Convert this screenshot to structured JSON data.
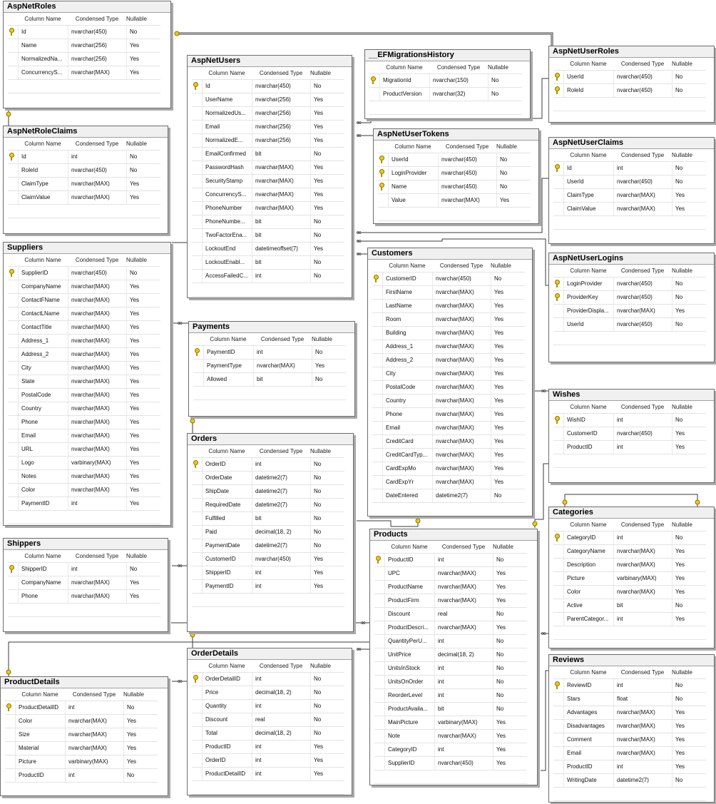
{
  "columns_header": {
    "name": "Column Name",
    "type": "Condensed Type",
    "nullable": "Nullable"
  },
  "tables": [
    {
      "name": "AspNetRoles",
      "rows": [
        {
          "col": "Id",
          "type": "nvarchar(450)",
          "nullable": "No",
          "pk": true
        },
        {
          "col": "Name",
          "type": "nvarchar(256)",
          "nullable": "Yes"
        },
        {
          "col": "NormalizedNa...",
          "type": "nvarchar(256)",
          "nullable": "Yes"
        },
        {
          "col": "ConcurrencyS...",
          "type": "nvarchar(MAX)",
          "nullable": "Yes"
        }
      ]
    },
    {
      "name": "AspNetRoleClaims",
      "rows": [
        {
          "col": "Id",
          "type": "int",
          "nullable": "No",
          "pk": true
        },
        {
          "col": "RoleId",
          "type": "nvarchar(450)",
          "nullable": "No"
        },
        {
          "col": "ClaimType",
          "type": "nvarchar(MAX)",
          "nullable": "Yes"
        },
        {
          "col": "ClaimValue",
          "type": "nvarchar(MAX)",
          "nullable": "Yes"
        }
      ]
    },
    {
      "name": "Suppliers",
      "rows": [
        {
          "col": "SupplierID",
          "type": "nvarchar(450)",
          "nullable": "No",
          "pk": true
        },
        {
          "col": "CompanyName",
          "type": "nvarchar(MAX)",
          "nullable": "Yes"
        },
        {
          "col": "ContactFName",
          "type": "nvarchar(MAX)",
          "nullable": "Yes"
        },
        {
          "col": "ContactLName",
          "type": "nvarchar(MAX)",
          "nullable": "Yes"
        },
        {
          "col": "ContactTitle",
          "type": "nvarchar(MAX)",
          "nullable": "Yes"
        },
        {
          "col": "Address_1",
          "type": "nvarchar(MAX)",
          "nullable": "Yes"
        },
        {
          "col": "Address_2",
          "type": "nvarchar(MAX)",
          "nullable": "Yes"
        },
        {
          "col": "City",
          "type": "nvarchar(MAX)",
          "nullable": "Yes"
        },
        {
          "col": "State",
          "type": "nvarchar(MAX)",
          "nullable": "Yes"
        },
        {
          "col": "PostalCode",
          "type": "nvarchar(MAX)",
          "nullable": "Yes"
        },
        {
          "col": "Country",
          "type": "nvarchar(MAX)",
          "nullable": "Yes"
        },
        {
          "col": "Phone",
          "type": "nvarchar(MAX)",
          "nullable": "Yes"
        },
        {
          "col": "Email",
          "type": "nvarchar(MAX)",
          "nullable": "Yes"
        },
        {
          "col": "URL",
          "type": "nvarchar(MAX)",
          "nullable": "Yes"
        },
        {
          "col": "Logo",
          "type": "varbinary(MAX)",
          "nullable": "Yes"
        },
        {
          "col": "Notes",
          "type": "nvarchar(MAX)",
          "nullable": "Yes"
        },
        {
          "col": "Color",
          "type": "nvarchar(MAX)",
          "nullable": "Yes"
        },
        {
          "col": "PaymentID",
          "type": "int",
          "nullable": "Yes"
        }
      ]
    },
    {
      "name": "Shippers",
      "rows": [
        {
          "col": "ShipperID",
          "type": "int",
          "nullable": "No",
          "pk": true
        },
        {
          "col": "CompanyName",
          "type": "nvarchar(MAX)",
          "nullable": "Yes"
        },
        {
          "col": "Phone",
          "type": "nvarchar(MAX)",
          "nullable": "Yes"
        }
      ]
    },
    {
      "name": "ProductDetails",
      "rows": [
        {
          "col": "ProductDetailID",
          "type": "int",
          "nullable": "No",
          "pk": true
        },
        {
          "col": "Color",
          "type": "nvarchar(MAX)",
          "nullable": "Yes"
        },
        {
          "col": "Size",
          "type": "nvarchar(MAX)",
          "nullable": "Yes"
        },
        {
          "col": "Material",
          "type": "nvarchar(MAX)",
          "nullable": "Yes"
        },
        {
          "col": "Picture",
          "type": "varbinary(MAX)",
          "nullable": "Yes"
        },
        {
          "col": "ProductID",
          "type": "int",
          "nullable": "No"
        }
      ]
    },
    {
      "name": "AspNetUsers",
      "rows": [
        {
          "col": "Id",
          "type": "nvarchar(450)",
          "nullable": "No",
          "pk": true
        },
        {
          "col": "UserName",
          "type": "nvarchar(256)",
          "nullable": "Yes"
        },
        {
          "col": "NormalizedUs...",
          "type": "nvarchar(256)",
          "nullable": "Yes"
        },
        {
          "col": "Email",
          "type": "nvarchar(256)",
          "nullable": "Yes"
        },
        {
          "col": "NormalizedE...",
          "type": "nvarchar(256)",
          "nullable": "Yes"
        },
        {
          "col": "EmailConfirmed",
          "type": "bit",
          "nullable": "No"
        },
        {
          "col": "PasswordHash",
          "type": "nvarchar(MAX)",
          "nullable": "Yes"
        },
        {
          "col": "SecurityStamp",
          "type": "nvarchar(MAX)",
          "nullable": "Yes"
        },
        {
          "col": "ConcurrencyS...",
          "type": "nvarchar(MAX)",
          "nullable": "Yes"
        },
        {
          "col": "PhoneNumber",
          "type": "nvarchar(MAX)",
          "nullable": "Yes"
        },
        {
          "col": "PhoneNumbe...",
          "type": "bit",
          "nullable": "No"
        },
        {
          "col": "TwoFactorEna...",
          "type": "bit",
          "nullable": "No"
        },
        {
          "col": "LockoutEnd",
          "type": "datetimeoffset(7)",
          "nullable": "Yes"
        },
        {
          "col": "LockoutEnabl...",
          "type": "bit",
          "nullable": "No"
        },
        {
          "col": "AccessFailedC...",
          "type": "int",
          "nullable": "No"
        }
      ]
    },
    {
      "name": "Payments",
      "rows": [
        {
          "col": "PaymentID",
          "type": "int",
          "nullable": "No",
          "pk": true
        },
        {
          "col": "PaymentType",
          "type": "nvarchar(MAX)",
          "nullable": "Yes"
        },
        {
          "col": "Allowed",
          "type": "bit",
          "nullable": "No"
        }
      ]
    },
    {
      "name": "Orders",
      "rows": [
        {
          "col": "OrderID",
          "type": "int",
          "nullable": "No",
          "pk": true
        },
        {
          "col": "OrderDate",
          "type": "datetime2(7)",
          "nullable": "No"
        },
        {
          "col": "ShipDate",
          "type": "datetime2(7)",
          "nullable": "No"
        },
        {
          "col": "RequiredDate",
          "type": "datetime2(7)",
          "nullable": "No"
        },
        {
          "col": "Fulfilled",
          "type": "bit",
          "nullable": "No"
        },
        {
          "col": "Paid",
          "type": "decimal(18, 2)",
          "nullable": "No"
        },
        {
          "col": "PaymentDate",
          "type": "datetime2(7)",
          "nullable": "No"
        },
        {
          "col": "CustomerID",
          "type": "nvarchar(450)",
          "nullable": "Yes"
        },
        {
          "col": "ShipperID",
          "type": "int",
          "nullable": "Yes"
        },
        {
          "col": "PaymentID",
          "type": "int",
          "nullable": "Yes"
        }
      ]
    },
    {
      "name": "OrderDetails",
      "rows": [
        {
          "col": "OrderDetailID",
          "type": "int",
          "nullable": "No",
          "pk": true
        },
        {
          "col": "Price",
          "type": "decimal(18, 2)",
          "nullable": "No"
        },
        {
          "col": "Quantity",
          "type": "int",
          "nullable": "No"
        },
        {
          "col": "Discount",
          "type": "real",
          "nullable": "No"
        },
        {
          "col": "Total",
          "type": "decimal(18, 2)",
          "nullable": "No"
        },
        {
          "col": "ProductID",
          "type": "int",
          "nullable": "Yes"
        },
        {
          "col": "OrderID",
          "type": "int",
          "nullable": "Yes"
        },
        {
          "col": "ProductDetailID",
          "type": "int",
          "nullable": "Yes"
        }
      ]
    },
    {
      "name": "__EFMigrationsHistory",
      "rows": [
        {
          "col": "MigrationId",
          "type": "nvarchar(150)",
          "nullable": "No",
          "pk": true
        },
        {
          "col": "ProductVersion",
          "type": "nvarchar(32)",
          "nullable": "No"
        }
      ]
    },
    {
      "name": "AspNetUserTokens",
      "rows": [
        {
          "col": "UserId",
          "type": "nvarchar(450)",
          "nullable": "No",
          "pk": true
        },
        {
          "col": "LoginProvider",
          "type": "nvarchar(450)",
          "nullable": "No",
          "pk": true
        },
        {
          "col": "Name",
          "type": "nvarchar(450)",
          "nullable": "No",
          "pk": true
        },
        {
          "col": "Value",
          "type": "nvarchar(MAX)",
          "nullable": "Yes"
        }
      ]
    },
    {
      "name": "Customers",
      "rows": [
        {
          "col": "CustomerID",
          "type": "nvarchar(450)",
          "nullable": "No",
          "pk": true
        },
        {
          "col": "FirstName",
          "type": "nvarchar(MAX)",
          "nullable": "Yes"
        },
        {
          "col": "LastName",
          "type": "nvarchar(MAX)",
          "nullable": "Yes"
        },
        {
          "col": "Room",
          "type": "nvarchar(MAX)",
          "nullable": "Yes"
        },
        {
          "col": "Building",
          "type": "nvarchar(MAX)",
          "nullable": "Yes"
        },
        {
          "col": "Address_1",
          "type": "nvarchar(MAX)",
          "nullable": "Yes"
        },
        {
          "col": "Address_2",
          "type": "nvarchar(MAX)",
          "nullable": "Yes"
        },
        {
          "col": "City",
          "type": "nvarchar(MAX)",
          "nullable": "Yes"
        },
        {
          "col": "PostalCode",
          "type": "nvarchar(MAX)",
          "nullable": "Yes"
        },
        {
          "col": "Country",
          "type": "nvarchar(MAX)",
          "nullable": "Yes"
        },
        {
          "col": "Phone",
          "type": "nvarchar(MAX)",
          "nullable": "Yes"
        },
        {
          "col": "Email",
          "type": "nvarchar(MAX)",
          "nullable": "Yes"
        },
        {
          "col": "CreditCard",
          "type": "nvarchar(MAX)",
          "nullable": "Yes"
        },
        {
          "col": "CreditCardTyp...",
          "type": "nvarchar(MAX)",
          "nullable": "Yes"
        },
        {
          "col": "CardExpMo",
          "type": "nvarchar(MAX)",
          "nullable": "Yes"
        },
        {
          "col": "CardExpYr",
          "type": "nvarchar(MAX)",
          "nullable": "Yes"
        },
        {
          "col": "DateEntered",
          "type": "datetime2(7)",
          "nullable": "No"
        }
      ]
    },
    {
      "name": "Products",
      "rows": [
        {
          "col": "ProductID",
          "type": "int",
          "nullable": "No",
          "pk": true
        },
        {
          "col": "UPC",
          "type": "nvarchar(MAX)",
          "nullable": "Yes"
        },
        {
          "col": "ProductName",
          "type": "nvarchar(MAX)",
          "nullable": "Yes"
        },
        {
          "col": "ProductFirm",
          "type": "nvarchar(MAX)",
          "nullable": "Yes"
        },
        {
          "col": "Discount",
          "type": "real",
          "nullable": "No"
        },
        {
          "col": "ProductDescri...",
          "type": "nvarchar(MAX)",
          "nullable": "Yes"
        },
        {
          "col": "QuantityPerU...",
          "type": "int",
          "nullable": "No"
        },
        {
          "col": "UnitPrice",
          "type": "decimal(18, 2)",
          "nullable": "No"
        },
        {
          "col": "UnitsInStock",
          "type": "int",
          "nullable": "No"
        },
        {
          "col": "UnitsOnOrder",
          "type": "int",
          "nullable": "No"
        },
        {
          "col": "ReorderLevel",
          "type": "int",
          "nullable": "No"
        },
        {
          "col": "ProductAvaila...",
          "type": "bit",
          "nullable": "No"
        },
        {
          "col": "MainPicture",
          "type": "varbinary(MAX)",
          "nullable": "Yes"
        },
        {
          "col": "Note",
          "type": "nvarchar(MAX)",
          "nullable": "Yes"
        },
        {
          "col": "CategoryID",
          "type": "int",
          "nullable": "Yes"
        },
        {
          "col": "SupplierID",
          "type": "nvarchar(450)",
          "nullable": "Yes"
        }
      ]
    },
    {
      "name": "AspNetUserRoles",
      "rows": [
        {
          "col": "UserId",
          "type": "nvarchar(450)",
          "nullable": "No",
          "pk": true
        },
        {
          "col": "RoleId",
          "type": "nvarchar(450)",
          "nullable": "No",
          "pk": true
        }
      ]
    },
    {
      "name": "AspNetUserClaims",
      "rows": [
        {
          "col": "Id",
          "type": "int",
          "nullable": "No",
          "pk": true
        },
        {
          "col": "UserId",
          "type": "nvarchar(450)",
          "nullable": "No"
        },
        {
          "col": "ClaimType",
          "type": "nvarchar(MAX)",
          "nullable": "Yes"
        },
        {
          "col": "ClaimValue",
          "type": "nvarchar(MAX)",
          "nullable": "Yes"
        }
      ]
    },
    {
      "name": "AspNetUserLogins",
      "rows": [
        {
          "col": "LoginProvider",
          "type": "nvarchar(450)",
          "nullable": "No",
          "pk": true
        },
        {
          "col": "ProviderKey",
          "type": "nvarchar(450)",
          "nullable": "No",
          "pk": true
        },
        {
          "col": "ProviderDispla...",
          "type": "nvarchar(MAX)",
          "nullable": "Yes"
        },
        {
          "col": "UserId",
          "type": "nvarchar(450)",
          "nullable": "No"
        }
      ]
    },
    {
      "name": "Wishes",
      "rows": [
        {
          "col": "WishID",
          "type": "int",
          "nullable": "No",
          "pk": true
        },
        {
          "col": "CustomerID",
          "type": "nvarchar(450)",
          "nullable": "Yes"
        },
        {
          "col": "ProductID",
          "type": "int",
          "nullable": "Yes"
        }
      ]
    },
    {
      "name": "Categories",
      "rows": [
        {
          "col": "CategoryID",
          "type": "int",
          "nullable": "No",
          "pk": true
        },
        {
          "col": "CategoryName",
          "type": "nvarchar(MAX)",
          "nullable": "Yes"
        },
        {
          "col": "Description",
          "type": "nvarchar(MAX)",
          "nullable": "Yes"
        },
        {
          "col": "Picture",
          "type": "varbinary(MAX)",
          "nullable": "Yes"
        },
        {
          "col": "Color",
          "type": "nvarchar(MAX)",
          "nullable": "Yes"
        },
        {
          "col": "Active",
          "type": "bit",
          "nullable": "No"
        },
        {
          "col": "ParentCategor...",
          "type": "int",
          "nullable": "Yes"
        }
      ]
    },
    {
      "name": "Reviews",
      "rows": [
        {
          "col": "ReviewID",
          "type": "int",
          "nullable": "No",
          "pk": true
        },
        {
          "col": "Stars",
          "type": "float",
          "nullable": "No"
        },
        {
          "col": "Advantages",
          "type": "nvarchar(MAX)",
          "nullable": "Yes"
        },
        {
          "col": "Disadvantages",
          "type": "nvarchar(MAX)",
          "nullable": "Yes"
        },
        {
          "col": "Comment",
          "type": "nvarchar(MAX)",
          "nullable": "Yes"
        },
        {
          "col": "Email",
          "type": "nvarchar(MAX)",
          "nullable": "Yes"
        },
        {
          "col": "ProductID",
          "type": "int",
          "nullable": "Yes"
        },
        {
          "col": "WritingDate",
          "type": "datetime2(7)",
          "nullable": "No"
        }
      ]
    }
  ],
  "relationships": [
    {
      "from": "AspNetRoleClaims",
      "to": "AspNetRoles"
    },
    {
      "from": "AspNetUserRoles",
      "to": "AspNetRoles"
    },
    {
      "from": "AspNetUserRoles",
      "to": "AspNetUsers"
    },
    {
      "from": "AspNetUserClaims",
      "to": "AspNetUsers"
    },
    {
      "from": "AspNetUserLogins",
      "to": "AspNetUsers"
    },
    {
      "from": "AspNetUserTokens",
      "to": "AspNetUsers"
    },
    {
      "from": "Suppliers",
      "to": "Payments"
    },
    {
      "from": "Orders",
      "to": "Payments"
    },
    {
      "from": "Orders",
      "to": "Shippers"
    },
    {
      "from": "Orders",
      "to": "Customers"
    },
    {
      "from": "Wishes",
      "to": "Customers"
    },
    {
      "from": "Wishes",
      "to": "Products"
    },
    {
      "from": "Products",
      "to": "Suppliers"
    },
    {
      "from": "Products",
      "to": "Categories"
    },
    {
      "from": "Categories",
      "to": "Categories"
    },
    {
      "from": "Reviews",
      "to": "Products"
    },
    {
      "from": "OrderDetails",
      "to": "Orders"
    },
    {
      "from": "OrderDetails",
      "to": "Products"
    },
    {
      "from": "OrderDetails",
      "to": "ProductDetails"
    },
    {
      "from": "ProductDetails",
      "to": "Products"
    }
  ],
  "colors": {
    "background": "#ffffff",
    "border": "#6d6d6d",
    "title_bg": "#f0f0f0",
    "key": "#f2c811",
    "line": "#3a3a3a"
  },
  "icons": {
    "primary_key": "key-icon",
    "relationship_one": "key-icon",
    "relationship_many": "infinity-icon"
  }
}
